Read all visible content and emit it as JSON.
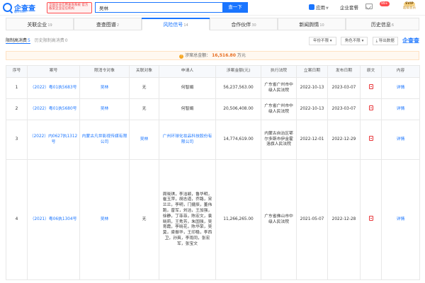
{
  "header": {
    "logo_text": "企查查",
    "logo_sub": "qcc.com",
    "slogan": "全国企业信用查询系统 官方备案企业征信机构",
    "search_value": "吴林",
    "search_button": "查一下",
    "app_label": "应用",
    "edition_label": "企业套餐",
    "message_count": "99+",
    "svip_label": "SVIP",
    "svip_sub": "超级会员"
  },
  "tabs": [
    {
      "label": "关联企业",
      "count": "19"
    },
    {
      "label": "查查图谱",
      "count": "2"
    },
    {
      "label": "风险信号",
      "count": "14"
    },
    {
      "label": "合作伙伴",
      "count": "30"
    },
    {
      "label": "新闻舆情",
      "count": "10"
    },
    {
      "label": "历史信息",
      "count": "6"
    }
  ],
  "subtabs": [
    {
      "label": "限制高消费",
      "count": "5"
    },
    {
      "label": "历史限制高消费",
      "count": "0"
    }
  ],
  "filters": {
    "year": "年份不限",
    "role": "角色不限",
    "export": "导出数据",
    "watermark": "企查查"
  },
  "total": {
    "label": "涉案总金额：",
    "amount": "16,516.80",
    "unit": "万元"
  },
  "table": {
    "headers": [
      "序号",
      "案号",
      "限消令对象",
      "关联对象",
      "申请人",
      "涉案金额(元)",
      "执行法院",
      "立案日期",
      "发布日期",
      "原文",
      "内容"
    ],
    "rows": [
      {
        "index": "1",
        "case_no": "（2022）粤01执5683号",
        "target": "吴林",
        "related": "无",
        "applicant": "何智娟",
        "amount": "56,237,563.00",
        "court": "广东省广州市中级人民法院",
        "filed": "2022-10-13",
        "published": "2023-03-07",
        "detail": "详情"
      },
      {
        "index": "2",
        "case_no": "（2022）粤01执5680号",
        "target": "吴林",
        "related": "无",
        "applicant": "何智娟",
        "amount": "20,506,408.00",
        "court": "广东省广州市中级人民法院",
        "filed": "2022-10-13",
        "published": "2023-03-07",
        "detail": "详情"
      },
      {
        "index": "3",
        "case_no": "（2022）内0627执1312号",
        "target": "内蒙古凡世影视传媒有限公司",
        "related": "吴林",
        "applicant": "广州环球化妆品科技股份有限公司",
        "amount": "14,774,619.00",
        "court": "内蒙古自治区鄂尔多斯市伊金霍洛旗人民法院",
        "filed": "2022-12-01",
        "published": "2022-12-29",
        "detail": "详情"
      },
      {
        "index": "4",
        "case_no": "（2021）粤06执1304号",
        "target": "吴林",
        "related": "无",
        "applicant": "周晓琪，李洁颖，鲁华明，崔玉萍，胡志道，乔路，宋兰兰，李明，门捷辰，董伟跑，曾军，刘洁，王加强，徐静，丁菲菲，陈宏文，袁晓莉，王秀芳，朱国强，吴育霞，李晓花，陈华荣，吴莫，梁振华，王印稳，李西卫，孙爽，李雨同，张宏军，张宝文",
        "amount": "11,266,265.00",
        "court": "广东省佛山市中级人民法院",
        "filed": "2021-05-07",
        "published": "2022-12-28",
        "detail": "详情"
      }
    ]
  }
}
